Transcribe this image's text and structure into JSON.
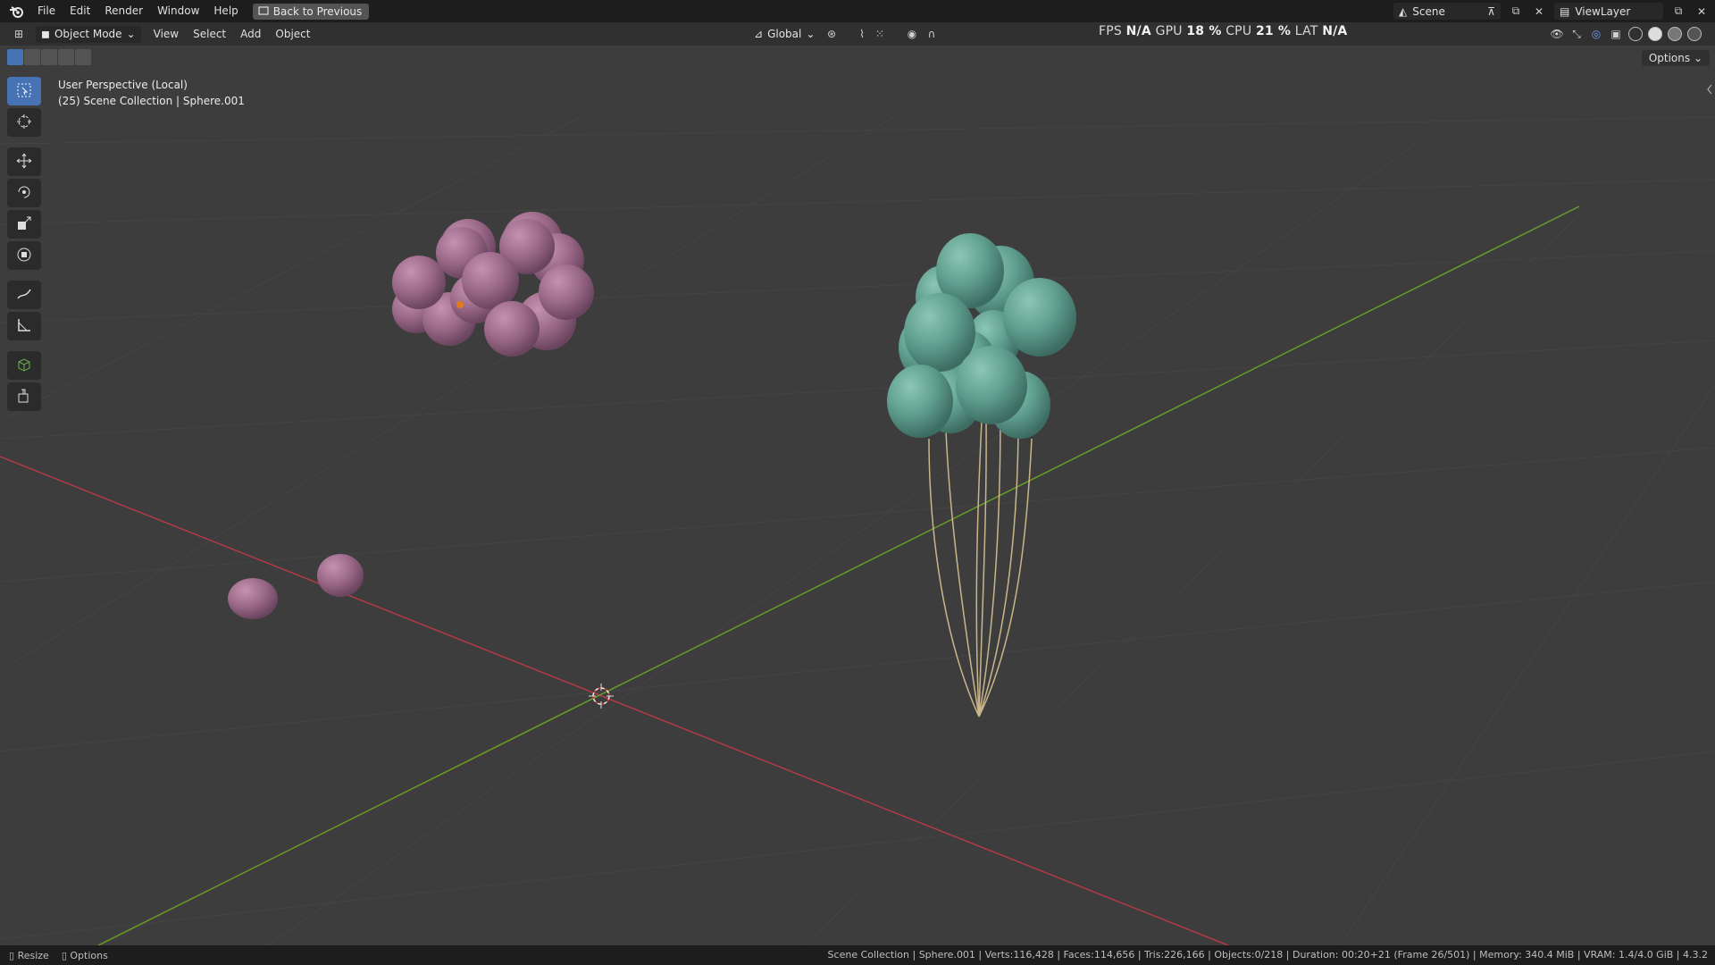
{
  "top_menu": [
    "File",
    "Edit",
    "Render",
    "Window",
    "Help"
  ],
  "back_button": "Back to Previous",
  "scene_field": "Scene",
  "view_layer_field": "ViewLayer",
  "mode_dropdown": "Object Mode",
  "header_menu": [
    "View",
    "Select",
    "Add",
    "Object"
  ],
  "orientation_dropdown": "Global",
  "stats": {
    "fps_label": "FPS",
    "fps_value": "N/A",
    "gpu_label": "GPU",
    "gpu_value": "18 %",
    "cpu_label": "CPU",
    "cpu_value": "21 %",
    "lat_label": "LAT",
    "lat_value": "N/A"
  },
  "options_button": "Options",
  "viewport": {
    "perspective_label": "User Perspective (Local)",
    "collection_label": "(25) Scene Collection | Sphere.001"
  },
  "status_bar": {
    "resize": "Resize",
    "options": "Options",
    "info": "Scene Collection | Sphere.001 | Verts:116,428 | Faces:114,656 | Tris:226,166 | Objects:0/218 | Duration: 00:20+21 (Frame 26/501) | Memory: 340.4 MiB | VRAM: 1.4/4.0 GiB | 4.3.2"
  },
  "colors": {
    "pink_balloon": "#9c6a89",
    "teal_balloon": "#5f9e8e",
    "x_axis": "#b23a48",
    "y_axis": "#6a9a2a",
    "accent": "#4772b3"
  },
  "tools": [
    "select-box-icon",
    "cursor-icon",
    "move-icon",
    "rotate-icon",
    "scale-icon",
    "transform-icon",
    "annotate-icon",
    "measure-icon",
    "add-cube-icon",
    "extrude-icon"
  ]
}
